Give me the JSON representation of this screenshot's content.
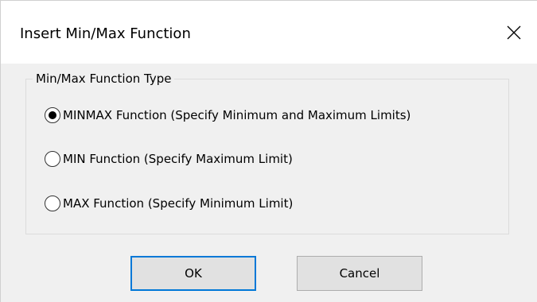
{
  "window": {
    "title": "Insert Min/Max Function",
    "close_icon": "close-icon"
  },
  "group": {
    "legend": "Min/Max Function Type",
    "options": [
      {
        "label": "MINMAX Function (Specify Minimum and Maximum Limits)",
        "selected": true
      },
      {
        "label": "MIN Function (Specify Maximum Limit)",
        "selected": false
      },
      {
        "label": "MAX Function (Specify Minimum Limit)",
        "selected": false
      }
    ]
  },
  "buttons": {
    "ok_label": "OK",
    "cancel_label": "Cancel"
  },
  "colors": {
    "background": "#f0f0f0",
    "title_bar": "#ffffff",
    "button_face": "#e1e1e1",
    "default_button_border": "#0078d7"
  }
}
